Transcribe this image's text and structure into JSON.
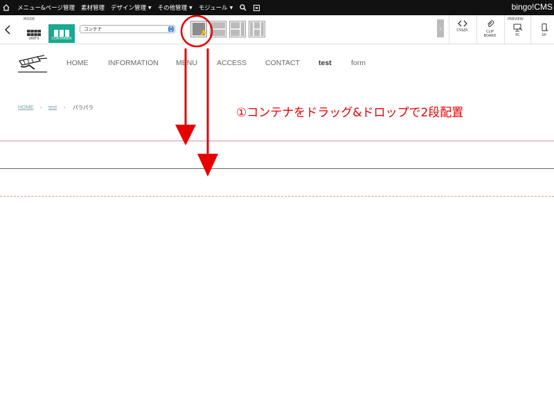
{
  "admin_bar": {
    "menu_items": [
      {
        "label": "メニュー&ページ管理",
        "dropdown": false
      },
      {
        "label": "素材管理",
        "dropdown": false
      },
      {
        "label": "デザイン管理",
        "dropdown": true
      },
      {
        "label": "その他管理",
        "dropdown": true
      },
      {
        "label": "モジュール",
        "dropdown": true
      }
    ],
    "brand": "bingo!CMS",
    "icons": [
      "home-icon",
      "search-icon",
      "exit-icon"
    ]
  },
  "toolbar": {
    "mode_label": "MODE",
    "mode_units_label": "UNITS",
    "mode_container_label": "CONTAINER",
    "selected_container": "コンテナ",
    "layout_buttons": [
      "layout-single",
      "layout-two-rows",
      "layout-two-cols",
      "layout-three-cols"
    ],
    "css_js_label": "CSS/JS",
    "clipboard_label_1": "CLIP",
    "clipboard_label_2": "BOARD",
    "preview_label": "PREVIEW",
    "pc_label": "PC",
    "sp_label": "SP",
    "accent_color": "#19a98f"
  },
  "site_nav": {
    "items": [
      "HOME",
      "INFORMATION",
      "MENU",
      "ACCESS",
      "CONTACT",
      "test",
      "form"
    ],
    "active": "test"
  },
  "breadcrumb": {
    "home": "HOME",
    "test": "test",
    "current": "パラパラ",
    "sep": "›"
  },
  "annotation": {
    "text": "①コンテナをドラッグ&ドロップで2段配置",
    "color": "#e60000"
  }
}
